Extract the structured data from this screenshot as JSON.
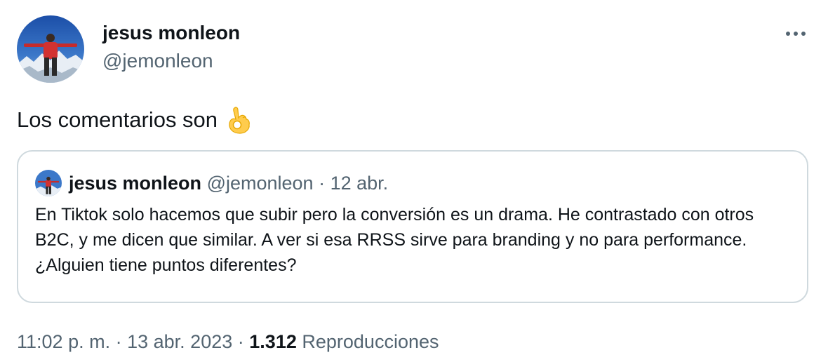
{
  "tweet": {
    "author": {
      "name": "jesus monleon",
      "handle": "@jemonleon"
    },
    "text": "Los comentarios son",
    "emoji": "ok-hand-emoji",
    "quoted": {
      "author_name": "jesus monleon",
      "handle": "@jemonleon",
      "separator": "·",
      "date": "12 abr.",
      "text": "En Tiktok solo hacemos que subir pero la conversión es un drama. He contrastado con otros B2C, y me dicen que similar. A ver si esa RRSS sirve para branding y no para performance. ¿Alguien tiene puntos diferentes?"
    },
    "meta": {
      "time": "11:02 p. m.",
      "separator": "·",
      "date": "13 abr. 2023",
      "views_count": "1.312",
      "views_label": "Reproducciones"
    }
  },
  "icons": {
    "more": "more-horizontal-icon"
  },
  "colors": {
    "text_primary": "#0f1419",
    "text_secondary": "#536471",
    "border": "#cfd9de"
  }
}
